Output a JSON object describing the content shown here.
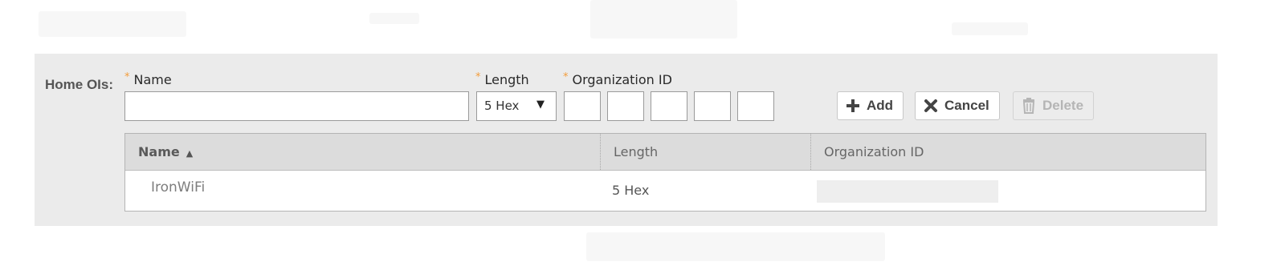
{
  "section": {
    "label": "Home OIs:"
  },
  "form": {
    "required_marker": "*",
    "name_label": "Name",
    "name_value": "",
    "length_label": "Length",
    "length_selected": "5 Hex",
    "org_id_label": "Organization ID",
    "org_id_segments": [
      "",
      "",
      "",
      "",
      ""
    ]
  },
  "buttons": {
    "add_label": "Add",
    "cancel_label": "Cancel",
    "delete_label": "Delete"
  },
  "table": {
    "columns": [
      "Name",
      "Length",
      "Organization ID"
    ],
    "sorted_column": "Name",
    "sort_direction": "ascending",
    "rows": [
      {
        "name": "IronWiFi",
        "length": "5 Hex",
        "organization_id": ""
      }
    ]
  },
  "icons": {
    "add": "plus-icon",
    "cancel": "x-icon",
    "delete": "trash-icon",
    "sort": "sort-ascending-icon",
    "dropdown": "dropdown-arrow-icon"
  },
  "colors": {
    "required_marker": "#f39c3a",
    "panel_background": "#ebebeb",
    "table_header_background": "#dcdcdc"
  }
}
